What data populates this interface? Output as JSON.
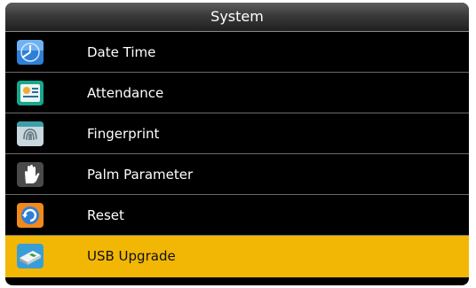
{
  "header": {
    "title": "System"
  },
  "menu": {
    "items": [
      {
        "label": "Date Time",
        "icon": "clock-icon"
      },
      {
        "label": "Attendance",
        "icon": "attendance-icon"
      },
      {
        "label": "Fingerprint",
        "icon": "fingerprint-icon"
      },
      {
        "label": "Palm Parameter",
        "icon": "palm-icon"
      },
      {
        "label": "Reset",
        "icon": "reset-icon"
      },
      {
        "label": "USB Upgrade",
        "icon": "usb-icon",
        "selected": true
      }
    ]
  },
  "colors": {
    "selected_bg": "#f2b705",
    "background": "#000000"
  }
}
